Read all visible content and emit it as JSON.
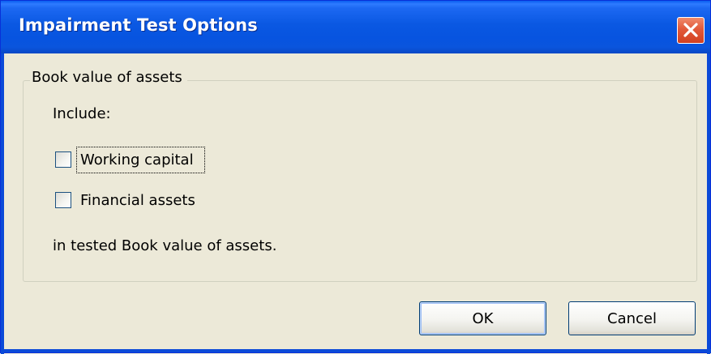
{
  "window": {
    "title": "Impairment Test Options"
  },
  "group": {
    "legend": "Book value of assets",
    "include_label": "Include:",
    "options": [
      {
        "label": "Working capital",
        "checked": false
      },
      {
        "label": "Financial assets",
        "checked": false
      }
    ],
    "footer_text": "in tested Book value of assets."
  },
  "buttons": {
    "ok_label": "OK",
    "cancel_label": "Cancel"
  },
  "icons": {
    "close": "close-icon"
  },
  "colors": {
    "titlebar": "#0A58E2",
    "close_button": "#E2593A",
    "dialog_background": "#ECE9D8"
  }
}
